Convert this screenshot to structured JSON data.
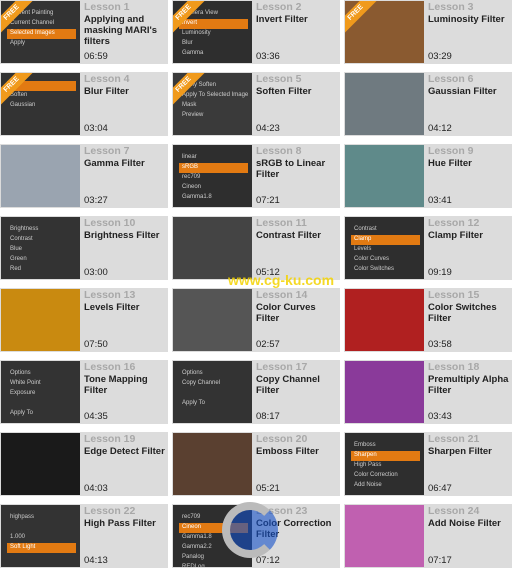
{
  "free_label": "FREE",
  "watermark": "www.cg-ku.com",
  "lessons": [
    {
      "lesson": "Lesson 1",
      "title": "Applying and masking MARI's filters",
      "duration": "06:59",
      "free": true,
      "thumb_color": "#333333",
      "menu": [
        "Current Painting",
        "Current Channel",
        "Selected Images",
        "Apply"
      ],
      "sel": 2
    },
    {
      "lesson": "Lesson 2",
      "title": "Invert Filter",
      "duration": "03:36",
      "free": true,
      "thumb_color": "#2e2e2e",
      "menu": [
        "Camera  View",
        "Invert",
        "Luminosity",
        "Blur",
        "Gamma"
      ],
      "sel": 1
    },
    {
      "lesson": "Lesson 3",
      "title": "Luminosity Filter",
      "duration": "03:29",
      "free": true,
      "thumb_color": "#8a5a30",
      "menu": [],
      "sel": -1
    },
    {
      "lesson": "Lesson 4",
      "title": "Blur Filter",
      "duration": "03:04",
      "free": true,
      "thumb_color": "#333333",
      "menu": [
        "Blur",
        "Soften",
        "Gaussian"
      ],
      "sel": 0
    },
    {
      "lesson": "Lesson 5",
      "title": "Soften Filter",
      "duration": "04:23",
      "free": true,
      "thumb_color": "#3a3a3a",
      "menu": [
        "Apply Soften",
        "Apply To  Selected Images",
        "Mask",
        "Preview"
      ],
      "sel": -1
    },
    {
      "lesson": "Lesson 6",
      "title": "Gaussian Filter",
      "duration": "04:12",
      "free": false,
      "thumb_color": "#6f7a80",
      "menu": [],
      "sel": -1
    },
    {
      "lesson": "Lesson 7",
      "title": "Gamma Filter",
      "duration": "03:27",
      "free": false,
      "thumb_color": "#9aa4b0",
      "menu": [],
      "sel": -1
    },
    {
      "lesson": "Lesson 8",
      "title": "sRGB to Linear Filter",
      "duration": "07:21",
      "free": false,
      "thumb_color": "#2e2e2e",
      "menu": [
        "linear",
        "sRGB",
        "rec709",
        "Cineon",
        "Gamma1.8"
      ],
      "sel": 1
    },
    {
      "lesson": "Lesson 9",
      "title": "Hue Filter",
      "duration": "03:41",
      "free": false,
      "thumb_color": "#5f8a8a",
      "menu": [],
      "sel": -1
    },
    {
      "lesson": "Lesson 10",
      "title": "Brightness Filter",
      "duration": "03:00",
      "free": false,
      "thumb_color": "#333333",
      "menu": [
        "Brightness",
        "Contrast",
        "Blue",
        "Green",
        "Red"
      ],
      "sel": -1
    },
    {
      "lesson": "Lesson 11",
      "title": "Contrast Filter",
      "duration": "05:12",
      "free": false,
      "thumb_color": "#444444",
      "menu": [],
      "sel": -1
    },
    {
      "lesson": "Lesson 12",
      "title": "Clamp Filter",
      "duration": "09:19",
      "free": false,
      "thumb_color": "#2e2e2e",
      "menu": [
        "Contrast",
        "Clamp",
        "Levels",
        "Color Curves",
        "Color Switches"
      ],
      "sel": 1
    },
    {
      "lesson": "Lesson 13",
      "title": "Levels Filter",
      "duration": "07:50",
      "free": false,
      "thumb_color": "#c98a10",
      "menu": [],
      "sel": -1
    },
    {
      "lesson": "Lesson 14",
      "title": "Color Curves Filter",
      "duration": "02:57",
      "free": false,
      "thumb_color": "#555555",
      "menu": [],
      "sel": -1
    },
    {
      "lesson": "Lesson 15",
      "title": "Color Switches Filter",
      "duration": "03:58",
      "free": false,
      "thumb_color": "#b02020",
      "menu": [],
      "sel": -1
    },
    {
      "lesson": "Lesson 16",
      "title": "Tone Mapping Filter",
      "duration": "04:35",
      "free": false,
      "thumb_color": "#333333",
      "menu": [
        "Options",
        "White Point",
        "Exposure",
        "",
        "Apply To"
      ],
      "sel": -1
    },
    {
      "lesson": "Lesson 17",
      "title": "Copy Channel Filter",
      "duration": "08:17",
      "free": false,
      "thumb_color": "#333333",
      "menu": [
        "Options",
        "Copy Channel",
        "",
        "Apply To"
      ],
      "sel": -1
    },
    {
      "lesson": "Lesson 18",
      "title": "Premultiply Alpha Filter",
      "duration": "03:43",
      "free": false,
      "thumb_color": "#8a3a9a",
      "menu": [],
      "sel": -1
    },
    {
      "lesson": "Lesson 19",
      "title": "Edge Detect Filter",
      "duration": "04:03",
      "free": false,
      "thumb_color": "#1a1a1a",
      "menu": [],
      "sel": -1
    },
    {
      "lesson": "Lesson 20",
      "title": "Emboss Filter",
      "duration": "05:21",
      "free": false,
      "thumb_color": "#5a4030",
      "menu": [],
      "sel": -1
    },
    {
      "lesson": "Lesson 21",
      "title": "Sharpen Filter",
      "duration": "06:47",
      "free": false,
      "thumb_color": "#2e2e2e",
      "menu": [
        "Emboss",
        "Sharpen",
        "High Pass",
        "Color Correction",
        "Add Noise"
      ],
      "sel": 1
    },
    {
      "lesson": "Lesson 22",
      "title": "High Pass Filter",
      "duration": "04:13",
      "free": false,
      "thumb_color": "#333333",
      "menu": [
        "highpass",
        "",
        "1.000",
        "Soft Light"
      ],
      "sel": 3
    },
    {
      "lesson": "Lesson 23",
      "title": "Color Correction Filter",
      "duration": "07:12",
      "free": false,
      "thumb_color": "#2e2e2e",
      "menu": [
        "rec709",
        "Cineon",
        "Gamma1.8",
        "Gamma2.2",
        "Panalog",
        "REDLog"
      ],
      "sel": 1
    },
    {
      "lesson": "Lesson 24",
      "title": "Add Noise Filter",
      "duration": "07:17",
      "free": false,
      "thumb_color": "#c060b0",
      "menu": [],
      "sel": -1
    }
  ]
}
